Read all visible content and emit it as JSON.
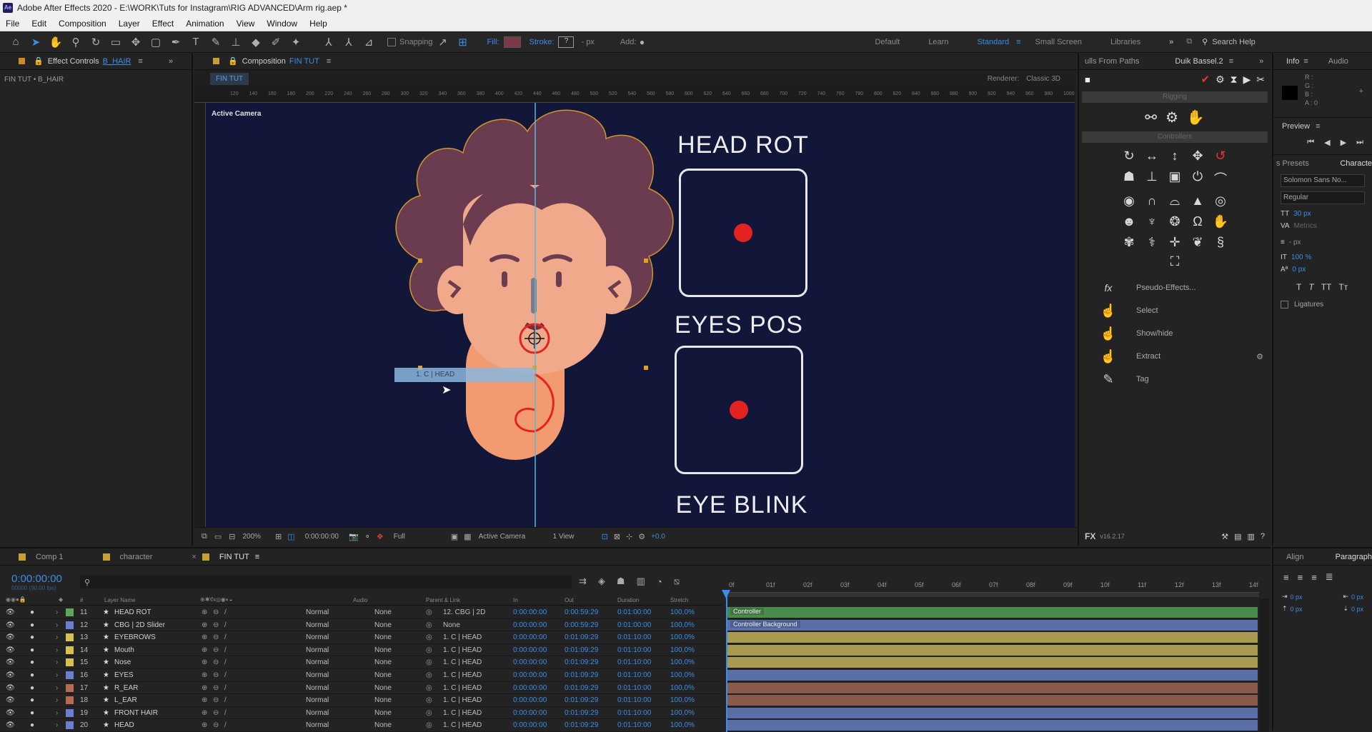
{
  "title_bar": {
    "app_icon": "Ae",
    "text": "Adobe After Effects 2020 - E:\\WORK\\Tuts for Instagram\\RIG ADVANCED\\Arm rig.aep *"
  },
  "menu": [
    "File",
    "Edit",
    "Composition",
    "Layer",
    "Effect",
    "Animation",
    "View",
    "Window",
    "Help"
  ],
  "toolbar": {
    "snapping": "Snapping",
    "fill": "Fill:",
    "stroke": "Stroke:",
    "stroke_value": "?",
    "px": "- px",
    "add": "Add:",
    "workspaces": [
      "Default",
      "Learn",
      "Standard",
      "Small Screen",
      "Libraries"
    ],
    "active_workspace": "Standard",
    "search_help": "Search Help",
    "fill_color": "#7b3a4a"
  },
  "effect_controls": {
    "tab": "Effect Controls",
    "layer": "B_HAIR",
    "breadcrumb": "FIN TUT • B_HAIR"
  },
  "composition": {
    "tab": "Composition",
    "comp_name": "FIN TUT",
    "subtab": "FIN TUT",
    "renderer_label": "Renderer:",
    "renderer": "Classic 3D",
    "active_camera_label": "Active Camera",
    "ruler_ticks": [
      "120",
      "140",
      "160",
      "180",
      "200",
      "220",
      "240",
      "260",
      "280",
      "300",
      "320",
      "340",
      "360",
      "380",
      "400",
      "420",
      "440",
      "460",
      "480",
      "500",
      "520",
      "540",
      "560",
      "580",
      "600",
      "620",
      "640",
      "660",
      "680",
      "700",
      "720",
      "740",
      "760",
      "780",
      "800",
      "820",
      "840",
      "860",
      "880",
      "900",
      "920",
      "940",
      "960",
      "980",
      "1000"
    ],
    "controllers": [
      {
        "title": "HEAD ROT"
      },
      {
        "title": "EYES POS"
      },
      {
        "title": "EYE BLINK"
      }
    ],
    "drag_label": "1. C | HEAD",
    "bottom": {
      "zoom": "200%",
      "timecode": "0:00:00:00",
      "resolution": "Full",
      "camera": "Active Camera",
      "views": "1 View",
      "exposure": "+0.0"
    },
    "bg_color": "#12173a",
    "hair_color": "#6b3c4f",
    "skin_color": "#f0a98a",
    "neck_color": "#f29a70"
  },
  "duik": {
    "tabs": [
      "ulls From Paths",
      "Duik Bassel.2"
    ],
    "sections": [
      "Rigging",
      "Controllers"
    ],
    "tools": [
      {
        "label": "Pseudo-Effects..."
      },
      {
        "label": "Select"
      },
      {
        "label": "Show/hide"
      },
      {
        "label": "Extract"
      },
      {
        "label": "Tag"
      }
    ],
    "version": "v16.2.17"
  },
  "right": {
    "tabs": [
      "Info",
      "Audio"
    ],
    "info_letters": [
      "R :",
      "G :",
      "B :",
      "A : 0"
    ],
    "preview": "Preview",
    "presets": "s Presets",
    "character": "Characte",
    "font": "Solomon Sans No...",
    "style": "Regular",
    "font_size": "30 px",
    "tracking": "Metrics",
    "leading": "- px",
    "vscale": "100 %",
    "baseline": "0 px",
    "ligatures": "Ligatures",
    "align": "Align",
    "paragraph": "Paragraph",
    "indent1": "0 px",
    "indent2": "0 px",
    "indent3": "0 px",
    "indent4": "0 px"
  },
  "timeline": {
    "tabs": [
      {
        "name": "Comp 1",
        "color": "#c8a030"
      },
      {
        "name": "character",
        "color": "#c8a030"
      },
      {
        "name": "FIN TUT",
        "color": "#c8a030"
      }
    ],
    "timecode": "0:00:00:00",
    "timecode_sub": "00000 (30.00 fps)",
    "headers": [
      "#",
      "Layer Name",
      "Audio",
      "Parent & Link",
      "In",
      "Out",
      "Duration",
      "Stretch"
    ],
    "ruler": [
      "0f",
      "01f",
      "02f",
      "03f",
      "04f",
      "05f",
      "06f",
      "07f",
      "08f",
      "09f",
      "10f",
      "11f",
      "12f",
      "13f",
      "14f"
    ],
    "layers": [
      {
        "num": "11",
        "name": "HEAD ROT",
        "color": "#5ba85b",
        "mode": "Normal",
        "track": "None",
        "parent": "12. CBG | 2D",
        "in": "0:00:00:00",
        "out": "0:00:59:29",
        "dur": "0:01:00:00",
        "stretch": "100,0%",
        "bar": "#4a8a4a",
        "label": "Controller"
      },
      {
        "num": "12",
        "name": "CBG | 2D Slider",
        "color": "#6a7fd0",
        "mode": "Normal",
        "track": "None",
        "parent": "None",
        "in": "0:00:00:00",
        "out": "0:00:59:29",
        "dur": "0:01:00:00",
        "stretch": "100,0%",
        "bar": "#5a6fa8",
        "label": "Controller Background"
      },
      {
        "num": "13",
        "name": "EYEBROWS",
        "color": "#d8c050",
        "mode": "Normal",
        "track": "None",
        "parent": "1. C | HEAD",
        "in": "0:00:00:00",
        "out": "0:01:09:29",
        "dur": "0:01:10:00",
        "stretch": "100,0%",
        "bar": "#a89a50",
        "label": ""
      },
      {
        "num": "14",
        "name": "Mouth",
        "color": "#d8c050",
        "mode": "Normal",
        "track": "None",
        "parent": "1. C | HEAD",
        "in": "0:00:00:00",
        "out": "0:01:09:29",
        "dur": "0:01:10:00",
        "stretch": "100,0%",
        "bar": "#a89a50",
        "label": ""
      },
      {
        "num": "15",
        "name": "Nose",
        "color": "#d8c050",
        "mode": "Normal",
        "track": "None",
        "parent": "1. C | HEAD",
        "in": "0:00:00:00",
        "out": "0:01:09:29",
        "dur": "0:01:10:00",
        "stretch": "100,0%",
        "bar": "#a89a50",
        "label": ""
      },
      {
        "num": "16",
        "name": "EYES",
        "color": "#6a7fd0",
        "mode": "Normal",
        "track": "None",
        "parent": "1. C | HEAD",
        "in": "0:00:00:00",
        "out": "0:01:09:29",
        "dur": "0:01:10:00",
        "stretch": "100,0%",
        "bar": "#5a6fa8",
        "label": ""
      },
      {
        "num": "17",
        "name": "R_EAR",
        "color": "#b86a50",
        "mode": "Normal",
        "track": "None",
        "parent": "1. C | HEAD",
        "in": "0:00:00:00",
        "out": "0:01:09:29",
        "dur": "0:01:10:00",
        "stretch": "100,0%",
        "bar": "#8a5a4a",
        "label": ""
      },
      {
        "num": "18",
        "name": "L_EAR",
        "color": "#b86a50",
        "mode": "Normal",
        "track": "None",
        "parent": "1. C | HEAD",
        "in": "0:00:00:00",
        "out": "0:01:09:29",
        "dur": "0:01:10:00",
        "stretch": "100,0%",
        "bar": "#8a5a4a",
        "label": ""
      },
      {
        "num": "19",
        "name": "FRONT HAIR",
        "color": "#6a7fd0",
        "mode": "Normal",
        "track": "None",
        "parent": "1. C | HEAD",
        "in": "0:00:00:00",
        "out": "0:01:09:29",
        "dur": "0:01:10:00",
        "stretch": "100,0%",
        "bar": "#5a6fa8",
        "label": ""
      },
      {
        "num": "20",
        "name": "HEAD",
        "color": "#6a7fd0",
        "mode": "Normal",
        "track": "None",
        "parent": "1. C | HEAD",
        "in": "0:00:00:00",
        "out": "0:01:09:29",
        "dur": "0:01:10:00",
        "stretch": "100,0%",
        "bar": "#5a6fa8",
        "label": ""
      }
    ]
  }
}
